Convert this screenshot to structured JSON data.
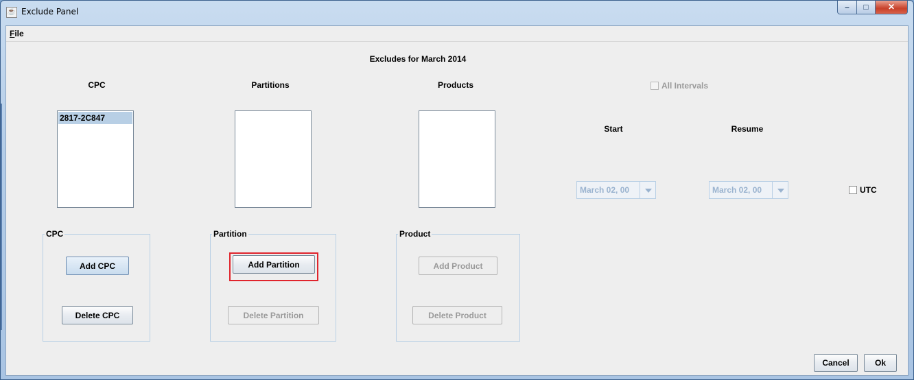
{
  "window": {
    "title": "Exclude Panel",
    "app_icon": "java-icon"
  },
  "menu": {
    "file_mnemonic": "F",
    "file_rest": "ile"
  },
  "heading": "Excludes for March 2014",
  "columns": {
    "cpc": "CPC",
    "partitions": "Partitions",
    "products": "Products"
  },
  "cpc_list": {
    "items": [
      "2817-2C847"
    ]
  },
  "all_intervals": {
    "label": "All Intervals",
    "checked": false,
    "enabled": false
  },
  "start": {
    "label": "Start",
    "value": "March 02, 00"
  },
  "resume": {
    "label": "Resume",
    "value": "March 02, 00"
  },
  "utc": {
    "label": "UTC",
    "checked": false
  },
  "groups": {
    "cpc": {
      "title": "CPC",
      "add": "Add CPC",
      "delete": "Delete CPC"
    },
    "partition": {
      "title": "Partition",
      "add": "Add Partition",
      "delete": "Delete Partition"
    },
    "product": {
      "title": "Product",
      "add": "Add Product",
      "delete": "Delete Product"
    }
  },
  "footer": {
    "cancel": "Cancel",
    "ok": "Ok"
  },
  "colors": {
    "highlight": "#e0242c",
    "selection": "#b8cfe5",
    "disabled_text": "#9a9a9a"
  }
}
